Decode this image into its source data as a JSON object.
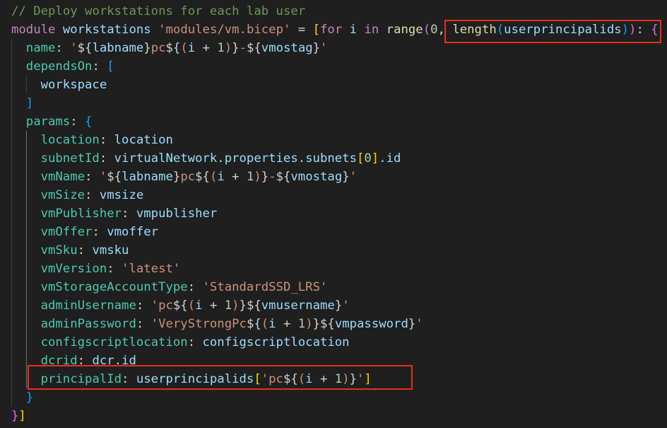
{
  "editor": {
    "language": "bicep",
    "highlight_color": "#e8301c",
    "lines": [
      {
        "indent": 0,
        "tokens": [
          {
            "t": "// Deploy workstations for each lab user",
            "c": "tok-comment"
          }
        ]
      },
      {
        "indent": 0,
        "tokens": [
          {
            "t": "module",
            "c": "tok-keyword"
          },
          {
            "t": " "
          },
          {
            "t": "workstations",
            "c": "tok-ident"
          },
          {
            "t": " "
          },
          {
            "t": "'modules/vm.bicep'",
            "c": "tok-string"
          },
          {
            "t": " = "
          },
          {
            "t": "[",
            "c": "b1"
          },
          {
            "t": "for",
            "c": "tok-keyword"
          },
          {
            "t": " "
          },
          {
            "t": "i",
            "c": "tok-ident"
          },
          {
            "t": " "
          },
          {
            "t": "in",
            "c": "tok-keyword"
          },
          {
            "t": " "
          },
          {
            "t": "range",
            "c": "tok-func"
          },
          {
            "t": "(",
            "c": "b2"
          },
          {
            "t": "0",
            "c": "tok-num"
          },
          {
            "t": ", "
          },
          {
            "t": "length",
            "c": "tok-func"
          },
          {
            "t": "(",
            "c": "b3"
          },
          {
            "t": "userprincipalids",
            "c": "tok-ident"
          },
          {
            "t": ")",
            "c": "b3"
          },
          {
            "t": ")",
            "c": "b2"
          },
          {
            "t": ": "
          },
          {
            "t": "{",
            "c": "b2"
          }
        ]
      },
      {
        "indent": 1,
        "tokens": [
          {
            "t": "name",
            "c": "tok-prop"
          },
          {
            "t": ": "
          },
          {
            "t": "'",
            "c": "tok-string"
          },
          {
            "t": "${",
            "c": "tok-interp"
          },
          {
            "t": "labname",
            "c": "tok-ident"
          },
          {
            "t": "}",
            "c": "tok-interp"
          },
          {
            "t": "pc",
            "c": "tok-string"
          },
          {
            "t": "${",
            "c": "tok-interp"
          },
          {
            "t": "(",
            "c": "tok-string"
          },
          {
            "t": "i",
            "c": "tok-ident"
          },
          {
            "t": " + "
          },
          {
            "t": "1",
            "c": "tok-num"
          },
          {
            "t": ")",
            "c": "tok-string"
          },
          {
            "t": "}",
            "c": "tok-interp"
          },
          {
            "t": "-",
            "c": "tok-string"
          },
          {
            "t": "${",
            "c": "tok-interp"
          },
          {
            "t": "vmostag",
            "c": "tok-ident"
          },
          {
            "t": "}",
            "c": "tok-interp"
          },
          {
            "t": "'",
            "c": "tok-string"
          }
        ]
      },
      {
        "indent": 1,
        "tokens": [
          {
            "t": "dependsOn",
            "c": "tok-prop"
          },
          {
            "t": ": "
          },
          {
            "t": "[",
            "c": "b3"
          }
        ]
      },
      {
        "indent": 2,
        "tokens": [
          {
            "t": "workspace",
            "c": "tok-ident"
          }
        ]
      },
      {
        "indent": 1,
        "tokens": [
          {
            "t": "]",
            "c": "b3"
          }
        ]
      },
      {
        "indent": 1,
        "tokens": [
          {
            "t": "params",
            "c": "tok-prop"
          },
          {
            "t": ": "
          },
          {
            "t": "{",
            "c": "b3"
          }
        ]
      },
      {
        "indent": 2,
        "tokens": [
          {
            "t": "location",
            "c": "tok-prop"
          },
          {
            "t": ": "
          },
          {
            "t": "location",
            "c": "tok-ident"
          }
        ]
      },
      {
        "indent": 2,
        "tokens": [
          {
            "t": "subnetId",
            "c": "tok-prop"
          },
          {
            "t": ": "
          },
          {
            "t": "virtualNetwork.properties.subnets",
            "c": "tok-ident"
          },
          {
            "t": "[",
            "c": "b1"
          },
          {
            "t": "0",
            "c": "tok-num"
          },
          {
            "t": "]",
            "c": "b1"
          },
          {
            "t": ".id",
            "c": "tok-ident"
          }
        ]
      },
      {
        "indent": 2,
        "tokens": [
          {
            "t": "vmName",
            "c": "tok-prop"
          },
          {
            "t": ": "
          },
          {
            "t": "'",
            "c": "tok-string"
          },
          {
            "t": "${",
            "c": "tok-interp"
          },
          {
            "t": "labname",
            "c": "tok-ident"
          },
          {
            "t": "}",
            "c": "tok-interp"
          },
          {
            "t": "pc",
            "c": "tok-string"
          },
          {
            "t": "${",
            "c": "tok-interp"
          },
          {
            "t": "(",
            "c": "tok-string"
          },
          {
            "t": "i",
            "c": "tok-ident"
          },
          {
            "t": " + "
          },
          {
            "t": "1",
            "c": "tok-num"
          },
          {
            "t": ")",
            "c": "tok-string"
          },
          {
            "t": "}",
            "c": "tok-interp"
          },
          {
            "t": "-",
            "c": "tok-string"
          },
          {
            "t": "${",
            "c": "tok-interp"
          },
          {
            "t": "vmostag",
            "c": "tok-ident"
          },
          {
            "t": "}",
            "c": "tok-interp"
          },
          {
            "t": "'",
            "c": "tok-string"
          }
        ]
      },
      {
        "indent": 2,
        "tokens": [
          {
            "t": "vmSize",
            "c": "tok-prop"
          },
          {
            "t": ": "
          },
          {
            "t": "vmsize",
            "c": "tok-ident"
          }
        ]
      },
      {
        "indent": 2,
        "tokens": [
          {
            "t": "vmPublisher",
            "c": "tok-prop"
          },
          {
            "t": ": "
          },
          {
            "t": "vmpublisher",
            "c": "tok-ident"
          }
        ]
      },
      {
        "indent": 2,
        "tokens": [
          {
            "t": "vmOffer",
            "c": "tok-prop"
          },
          {
            "t": ": "
          },
          {
            "t": "vmoffer",
            "c": "tok-ident"
          }
        ]
      },
      {
        "indent": 2,
        "tokens": [
          {
            "t": "vmSku",
            "c": "tok-prop"
          },
          {
            "t": ": "
          },
          {
            "t": "vmsku",
            "c": "tok-ident"
          }
        ]
      },
      {
        "indent": 2,
        "tokens": [
          {
            "t": "vmVersion",
            "c": "tok-prop"
          },
          {
            "t": ": "
          },
          {
            "t": "'latest'",
            "c": "tok-string"
          }
        ]
      },
      {
        "indent": 2,
        "tokens": [
          {
            "t": "vmStorageAccountType",
            "c": "tok-prop"
          },
          {
            "t": ": "
          },
          {
            "t": "'StandardSSD_LRS'",
            "c": "tok-string"
          }
        ]
      },
      {
        "indent": 2,
        "tokens": [
          {
            "t": "adminUsername",
            "c": "tok-prop"
          },
          {
            "t": ": "
          },
          {
            "t": "'pc",
            "c": "tok-string"
          },
          {
            "t": "${",
            "c": "tok-interp"
          },
          {
            "t": "(",
            "c": "tok-string"
          },
          {
            "t": "i",
            "c": "tok-ident"
          },
          {
            "t": " + "
          },
          {
            "t": "1",
            "c": "tok-num"
          },
          {
            "t": ")",
            "c": "tok-string"
          },
          {
            "t": "}",
            "c": "tok-interp"
          },
          {
            "t": "${",
            "c": "tok-interp"
          },
          {
            "t": "vmusername",
            "c": "tok-ident"
          },
          {
            "t": "}",
            "c": "tok-interp"
          },
          {
            "t": "'",
            "c": "tok-string"
          }
        ]
      },
      {
        "indent": 2,
        "tokens": [
          {
            "t": "adminPassword",
            "c": "tok-prop"
          },
          {
            "t": ": "
          },
          {
            "t": "'VeryStrongPc",
            "c": "tok-string"
          },
          {
            "t": "${",
            "c": "tok-interp"
          },
          {
            "t": "(",
            "c": "tok-string"
          },
          {
            "t": "i",
            "c": "tok-ident"
          },
          {
            "t": " + "
          },
          {
            "t": "1",
            "c": "tok-num"
          },
          {
            "t": ")",
            "c": "tok-string"
          },
          {
            "t": "}",
            "c": "tok-interp"
          },
          {
            "t": "${",
            "c": "tok-interp"
          },
          {
            "t": "vmpassword",
            "c": "tok-ident"
          },
          {
            "t": "}",
            "c": "tok-interp"
          },
          {
            "t": "'",
            "c": "tok-string"
          }
        ]
      },
      {
        "indent": 2,
        "tokens": [
          {
            "t": "configscriptlocation",
            "c": "tok-prop"
          },
          {
            "t": ": "
          },
          {
            "t": "configscriptlocation",
            "c": "tok-ident"
          }
        ]
      },
      {
        "indent": 2,
        "tokens": [
          {
            "t": "dcrid",
            "c": "tok-prop"
          },
          {
            "t": ": "
          },
          {
            "t": "dcr.id",
            "c": "tok-ident"
          }
        ]
      },
      {
        "indent": 2,
        "tokens": [
          {
            "t": "principalId",
            "c": "tok-prop"
          },
          {
            "t": ": "
          },
          {
            "t": "userprincipalids",
            "c": "tok-ident"
          },
          {
            "t": "[",
            "c": "b1"
          },
          {
            "t": "'pc",
            "c": "tok-string"
          },
          {
            "t": "${",
            "c": "tok-interp"
          },
          {
            "t": "(",
            "c": "tok-string"
          },
          {
            "t": "i",
            "c": "tok-ident"
          },
          {
            "t": " + "
          },
          {
            "t": "1",
            "c": "tok-num"
          },
          {
            "t": ")",
            "c": "tok-string"
          },
          {
            "t": "}",
            "c": "tok-interp"
          },
          {
            "t": "'",
            "c": "tok-string"
          },
          {
            "t": "]",
            "c": "b1"
          }
        ]
      },
      {
        "indent": 1,
        "tokens": [
          {
            "t": "}",
            "c": "b3"
          }
        ]
      },
      {
        "indent": 0,
        "tokens": [
          {
            "t": "}",
            "c": "b2"
          },
          {
            "t": "]",
            "c": "b1"
          }
        ]
      }
    ],
    "highlights": [
      {
        "label": "length(userprincipalids)): {",
        "line": 1
      },
      {
        "label": "principalId: userprincipalids['pc${(i + 1)}']",
        "line": 20
      }
    ]
  }
}
